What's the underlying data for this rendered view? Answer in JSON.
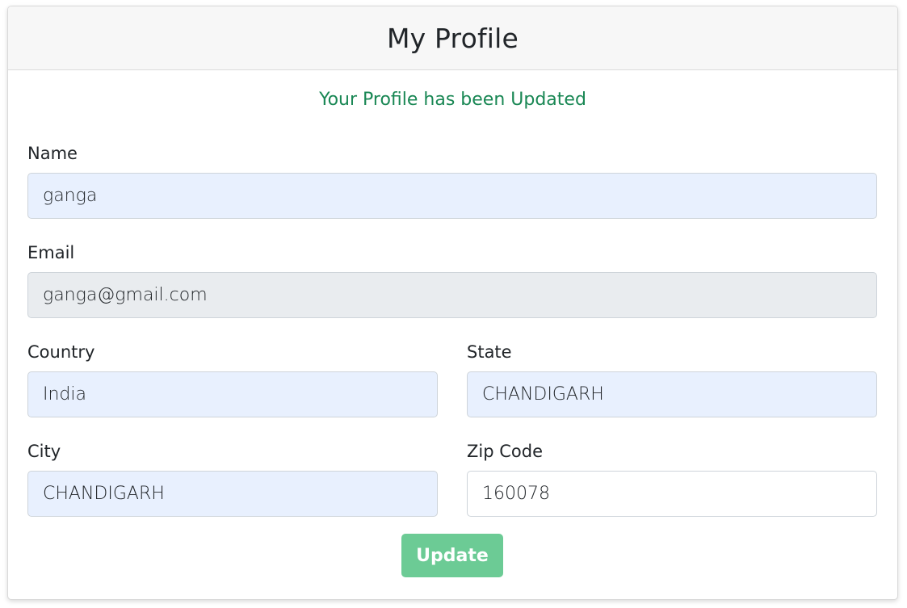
{
  "header": {
    "title": "My Profile"
  },
  "status": {
    "message": "Your Profile has been Updated",
    "color": "#198754"
  },
  "form": {
    "name": {
      "label": "Name",
      "value": "ganga"
    },
    "email": {
      "label": "Email",
      "value": "ganga@gmail.com"
    },
    "country": {
      "label": "Country",
      "value": "India"
    },
    "state": {
      "label": "State",
      "value": "CHANDIGARH"
    },
    "city": {
      "label": "City",
      "value": "CHANDIGARH"
    },
    "zip": {
      "label": "Zip Code",
      "value": "160078"
    },
    "submit_label": "Update"
  },
  "colors": {
    "autofill_bg": "#e8f0fe",
    "disabled_bg": "#e9ecef",
    "button_bg": "#6ccb95"
  }
}
